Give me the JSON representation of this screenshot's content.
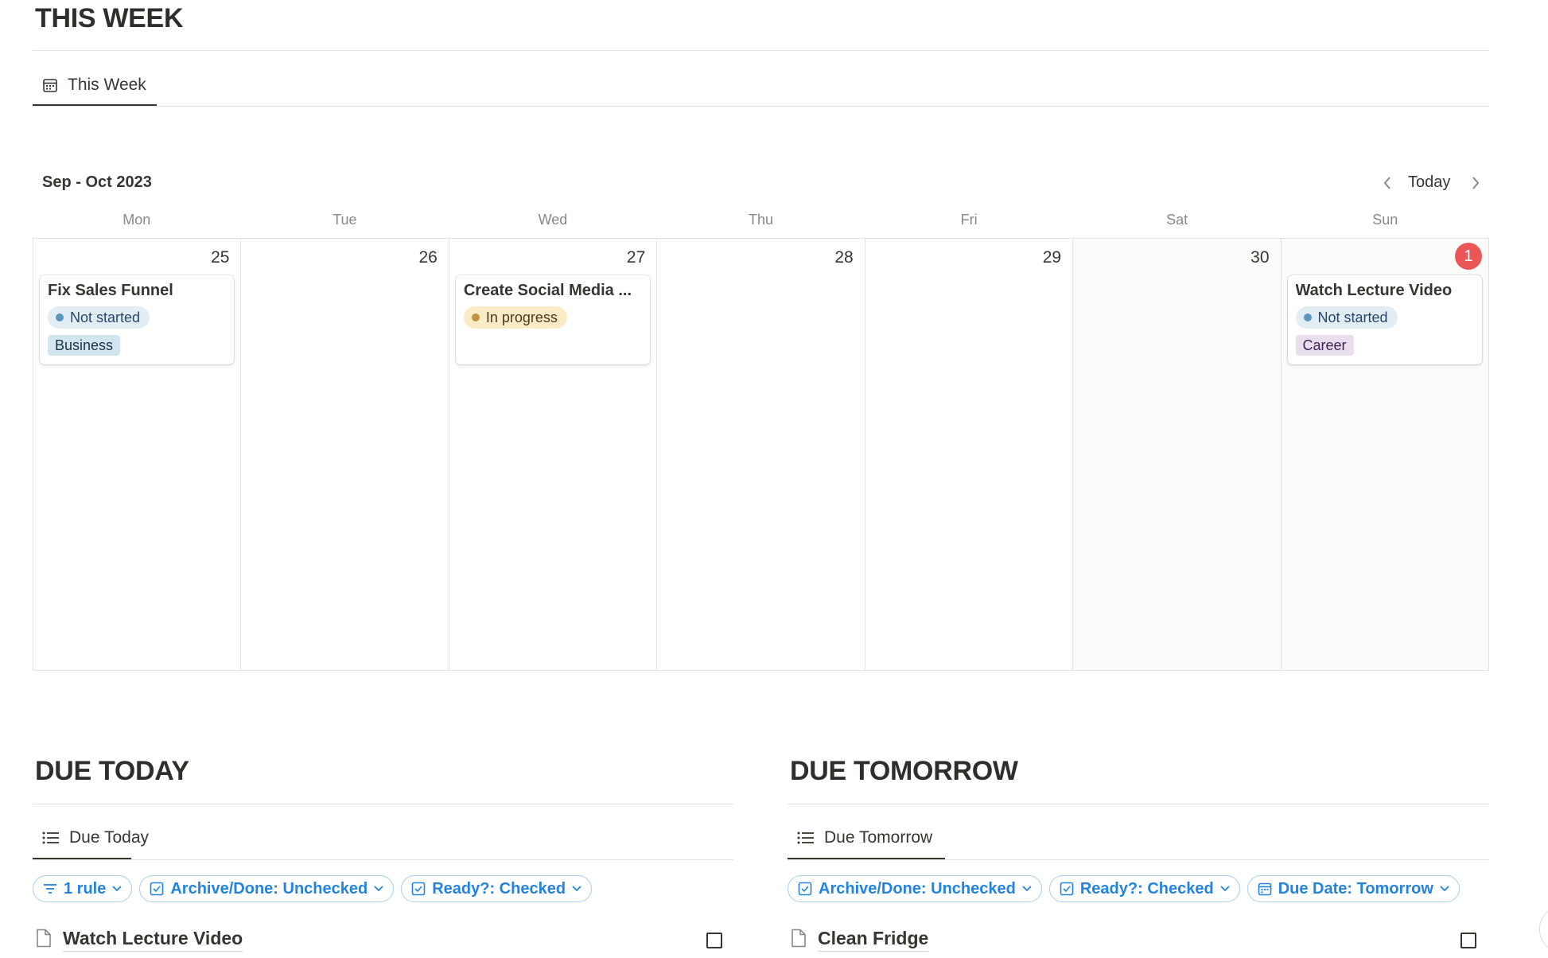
{
  "this_week": {
    "title": "THIS WEEK",
    "tab_label": "This Week",
    "month_label": "Sep - Oct 2023",
    "today_label": "Today",
    "weekdays": [
      "Mon",
      "Tue",
      "Wed",
      "Thu",
      "Fri",
      "Sat",
      "Sun"
    ],
    "days": [
      {
        "num": "25",
        "card": {
          "title": "Fix Sales Funnel",
          "status": "Not started",
          "tag": "Business"
        }
      },
      {
        "num": "26"
      },
      {
        "num": "27",
        "card": {
          "title": "Create Social Media ...",
          "status": "In progress"
        }
      },
      {
        "num": "28"
      },
      {
        "num": "29"
      },
      {
        "num": "30"
      },
      {
        "num": "1",
        "card": {
          "title": "Watch Lecture Video",
          "status": "Not started",
          "tag": "Career"
        }
      }
    ]
  },
  "due_today": {
    "title": "DUE TODAY",
    "tab_label": "Due Today",
    "filters": [
      "1 rule",
      "Archive/Done: Unchecked",
      "Ready?: Checked"
    ],
    "rows": [
      "Watch Lecture Video"
    ]
  },
  "due_tomorrow": {
    "title": "DUE TOMORROW",
    "tab_label": "Due Tomorrow",
    "filters": [
      "Archive/Done: Unchecked",
      "Ready?: Checked",
      "Due Date: Tomorrow"
    ],
    "rows": [
      "Clean Fridge"
    ]
  },
  "colors": {
    "accent": "#2383e2",
    "today_badge": "#eb5757",
    "not_started_bg": "#e3eef4",
    "in_progress_bg": "#fbecc8",
    "business_tag": "#d3e5ef",
    "career_tag": "#e8deee"
  },
  "icons": {
    "calendar_view": "calendar-icon",
    "list_view": "list-icon",
    "filter_rule": "filter-icon",
    "checkbox_filter": "checkbox-icon",
    "date_filter": "calendar-icon",
    "page": "page-icon"
  }
}
